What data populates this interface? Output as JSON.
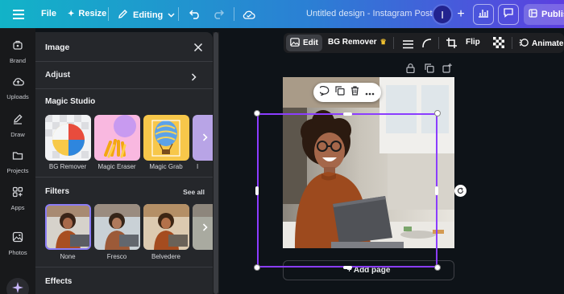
{
  "topbar": {
    "file_label": "File",
    "resize_label": "Resize",
    "mode_label": "Editing",
    "design_title": "Untitled design - Instagram Post",
    "avatar_initial": "I",
    "publish_label": "Publis",
    "gradient_colors": [
      "#12b3c8",
      "#2b7fd4",
      "#5c3fe0"
    ]
  },
  "rail": {
    "items": [
      {
        "label": "Brand",
        "icon": "brand-icon"
      },
      {
        "label": "Uploads",
        "icon": "cloud-upload-icon"
      },
      {
        "label": "Draw",
        "icon": "pen-icon"
      },
      {
        "label": "Projects",
        "icon": "folder-icon"
      },
      {
        "label": "Apps",
        "icon": "apps-grid-icon"
      },
      {
        "label": "Photos",
        "icon": "image-icon"
      }
    ]
  },
  "panel": {
    "title": "Image",
    "adjust_label": "Adjust",
    "magic_studio_heading": "Magic Studio",
    "magic_tools": [
      {
        "label": "BG Remover"
      },
      {
        "label": "Magic Eraser"
      },
      {
        "label": "Magic Grab"
      },
      {
        "label": "I"
      }
    ],
    "filters_heading": "Filters",
    "see_all_label": "See all",
    "filters": [
      {
        "label": "None",
        "selected": true
      },
      {
        "label": "Fresco",
        "selected": false
      },
      {
        "label": "Belvedere",
        "selected": false
      }
    ],
    "effects_heading": "Effects"
  },
  "context_toolbar": {
    "edit_label": "Edit",
    "bg_remover_label": "BG Remover",
    "flip_label": "Flip",
    "animate_label": "Animate"
  },
  "canvas": {
    "add_page_label": "+ Add page",
    "selection_color": "#8b3dff"
  }
}
